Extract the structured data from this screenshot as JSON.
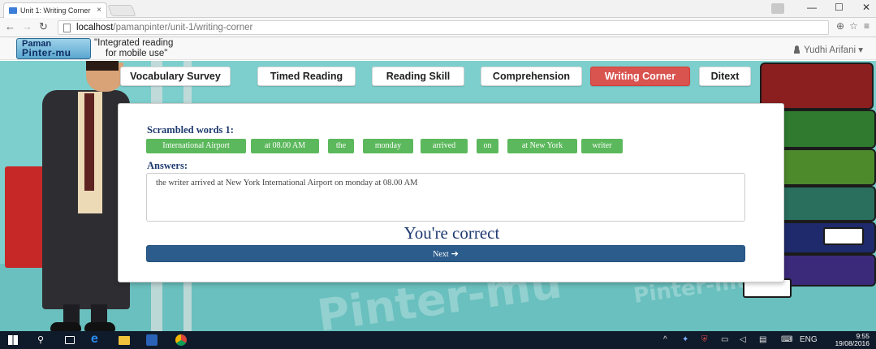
{
  "browser": {
    "tab_title": "Unit 1: Writing Corner",
    "tab_sound_icon": "speaker-icon",
    "tab_close": "×",
    "window_controls": [
      "—",
      "☐",
      "✕"
    ],
    "url_host": "localhost",
    "url_path": "/pamanpinter/unit-1/writing-corner"
  },
  "app": {
    "logo_line1": "Paman",
    "logo_line2": "Pinter-mu",
    "tagline_line1": "\"Integrated reading",
    "tagline_line2": "for mobile use\"",
    "user_name": "Yudhi Arifani",
    "user_caret": "▾"
  },
  "nav_tabs": [
    {
      "label": "Vocabulary Survey",
      "active": false
    },
    {
      "label": "Timed Reading",
      "active": false
    },
    {
      "label": "Reading Skill",
      "active": false
    },
    {
      "label": "Comprehension",
      "active": false
    },
    {
      "label": "Writing Corner",
      "active": true
    },
    {
      "label": "Ditext",
      "active": false
    }
  ],
  "exercise": {
    "scrambled_label": "Scrambled words 1:",
    "words": [
      "International Airport",
      "at 08.00 AM",
      "the",
      "monday",
      "arrived",
      "on",
      "at New York",
      "writer"
    ],
    "answers_label": "Answers:",
    "answer_text": "the writer arrived at New York International Airport on monday at 08.00 AM",
    "result_text": "You're correct",
    "next_label": "Next",
    "next_icon": "arrow-right-icon"
  },
  "taskbar": {
    "lang": "ENG",
    "time": "9:55",
    "date": "19/08/2016"
  },
  "colors": {
    "stage_bg": "#7ccfcd",
    "active_tab": "#d9534f",
    "chip_green": "#5cb85c",
    "next_button": "#2c5c8c",
    "heading_navy": "#1f3b70"
  }
}
